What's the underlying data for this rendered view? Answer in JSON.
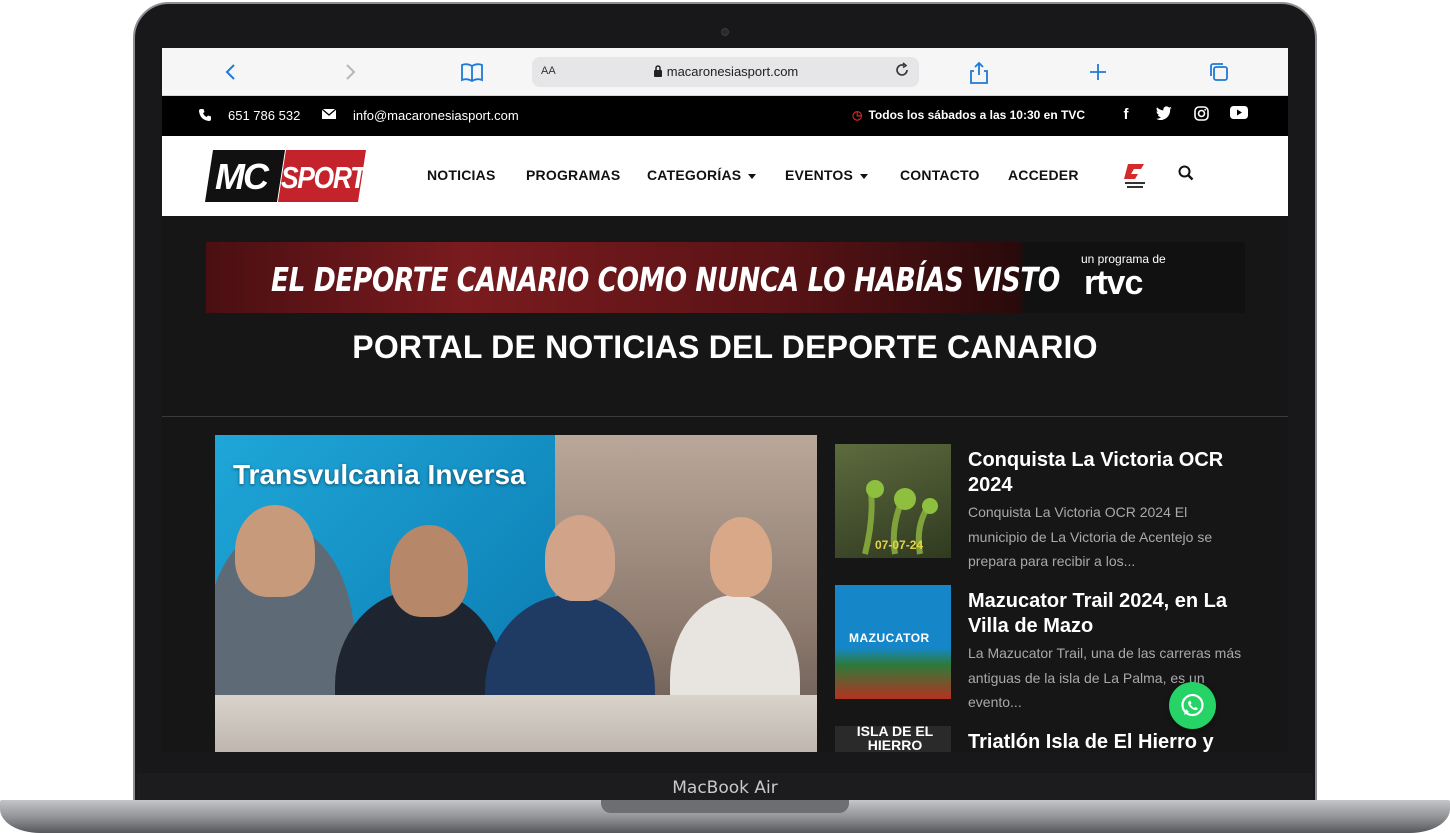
{
  "device": {
    "label": "MacBook Air"
  },
  "browser": {
    "text_size_label": "AA",
    "url": "macaronesiasport.com",
    "icons": [
      "back-icon",
      "forward-icon",
      "bookmarks-icon",
      "lock-icon",
      "reload-icon",
      "share-icon",
      "new-tab-icon",
      "tabs-icon"
    ]
  },
  "topbar": {
    "phone": "651 786 532",
    "email": "info@macaronesiasport.com",
    "schedule": "Todos los sábados a las 10:30 en TVC",
    "social": [
      "facebook-icon",
      "twitter-icon",
      "instagram-icon",
      "youtube-icon"
    ]
  },
  "header": {
    "logo_left": "MC",
    "logo_right": "SPORT",
    "nav": [
      {
        "label": "NOTICIAS",
        "dropdown": false
      },
      {
        "label": "PROGRAMAS",
        "dropdown": false
      },
      {
        "label": "CATEGORÍAS",
        "dropdown": true
      },
      {
        "label": "EVENTOS",
        "dropdown": true
      },
      {
        "label": "CONTACTO",
        "dropdown": false
      },
      {
        "label": "ACCEDER",
        "dropdown": false
      }
    ]
  },
  "banner": {
    "slogan": "EL DEPORTE CANARIO COMO NUNCA LO HABÍAS VISTO",
    "program_label": "un programa de",
    "brand": "rtvc"
  },
  "page_title": "PORTAL DE NOTICIAS DEL DEPORTE CANARIO",
  "featured": {
    "title": "Transvulcania Inversa"
  },
  "news": [
    {
      "title": "Conquista La Victoria OCR 2024",
      "excerpt": "Conquista La Victoria OCR 2024 El municipio de La Victoria de Acentejo se prepara para recibir a los...",
      "thumb_text": "07-07-24"
    },
    {
      "title": "Mazucator Trail 2024, en La Villa de Mazo",
      "excerpt": "La Mazucator Trail, una de las carreras más antiguas de la isla de La Palma, es un evento...",
      "thumb_text": "MAZUCATOR"
    },
    {
      "title": "Triatlón Isla de El Hierro y",
      "excerpt": "",
      "thumb_text": "ISLA DE EL HIERRO"
    }
  ],
  "colors": {
    "accent": "#c4232b",
    "background": "#161616",
    "whatsapp": "#25d366"
  }
}
